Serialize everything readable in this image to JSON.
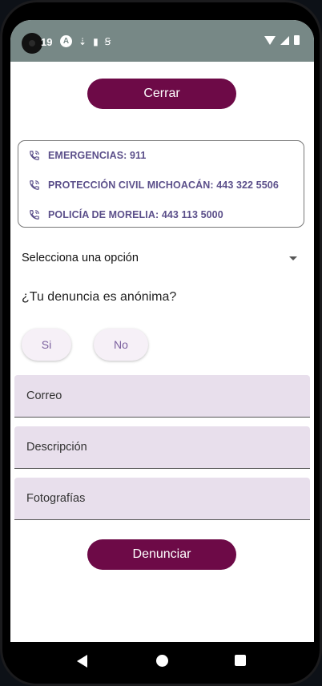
{
  "status_bar": {
    "time": "19",
    "icons": [
      "a-icon",
      "usb-icon",
      "sd-card-icon",
      "sim-icon",
      "wifi-icon",
      "signal-icon",
      "battery-icon"
    ]
  },
  "colors": {
    "primary": "#6d0a47",
    "status_bar": "#778886",
    "contact_text": "#5b4f8a",
    "field_bg": "#e8dfec",
    "pill_bg": "#f6f0f7",
    "pill_text": "#7a5f9e"
  },
  "header": {
    "close_label": "Cerrar"
  },
  "contacts": [
    {
      "icon": "phone-call-icon",
      "label": "EMERGENCIAS: 911"
    },
    {
      "icon": "phone-call-icon",
      "label": "PROTECCIÓN CIVIL MICHOACÁN: 443 322 5506"
    },
    {
      "icon": "phone-call-icon",
      "label": "POLICÍA DE MORELIA: 443 113 5000"
    }
  ],
  "form": {
    "select_placeholder": "Selecciona una opción",
    "anonymous_question": "¿Tu denuncia es anónima?",
    "options": {
      "yes": "Si",
      "no": "No"
    },
    "email_placeholder": "Correo",
    "description_placeholder": "Descripción",
    "photos_placeholder": "Fotografías",
    "submit_label": "Denunciar"
  }
}
